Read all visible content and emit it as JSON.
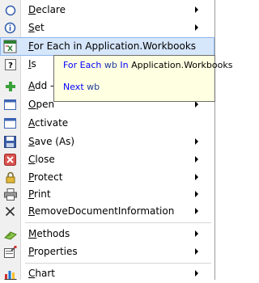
{
  "menu": {
    "items": [
      {
        "accel": "D",
        "rest": "eclare",
        "arrow": true
      },
      {
        "accel": "S",
        "rest": "et",
        "arrow": true
      },
      {
        "accel": "F",
        "rest": "or Each in Application.Workbooks",
        "arrow": false
      },
      {
        "accel": "I",
        "rest": "s",
        "arrow": false
      },
      {
        "accel": "A",
        "rest": "dd -",
        "arrow": false
      },
      {
        "accel": "O",
        "rest": "pen",
        "arrow": true
      },
      {
        "accel": "A",
        "rest": "ctivate",
        "arrow": false
      },
      {
        "accel": "S",
        "rest": "ave (As)",
        "arrow": true
      },
      {
        "accel": "C",
        "rest": "lose",
        "arrow": true
      },
      {
        "accel": "P",
        "rest": "rotect",
        "arrow": true
      },
      {
        "accel": "P",
        "rest": "rint",
        "arrow": true
      },
      {
        "accel": "R",
        "rest": "emoveDocumentInformation",
        "arrow": true
      },
      {
        "accel": "M",
        "rest": "ethods",
        "arrow": true
      },
      {
        "accel": "P",
        "rest": "roperties",
        "arrow": true
      },
      {
        "accel": "C",
        "rest": "hart",
        "arrow": true
      }
    ]
  },
  "tooltip": {
    "line1": {
      "kw1": "For Each",
      "mid1": "wb",
      "kw2": "In",
      "tail": "Application.Workbooks"
    },
    "line2": {
      "kw": "Next",
      "var": "wb"
    }
  },
  "colors": {
    "highlight_bg": "#d6e6fb",
    "highlight_border": "#8eb6ec",
    "tooltip_bg": "#ffffe1",
    "keyword": "#0000ff"
  }
}
